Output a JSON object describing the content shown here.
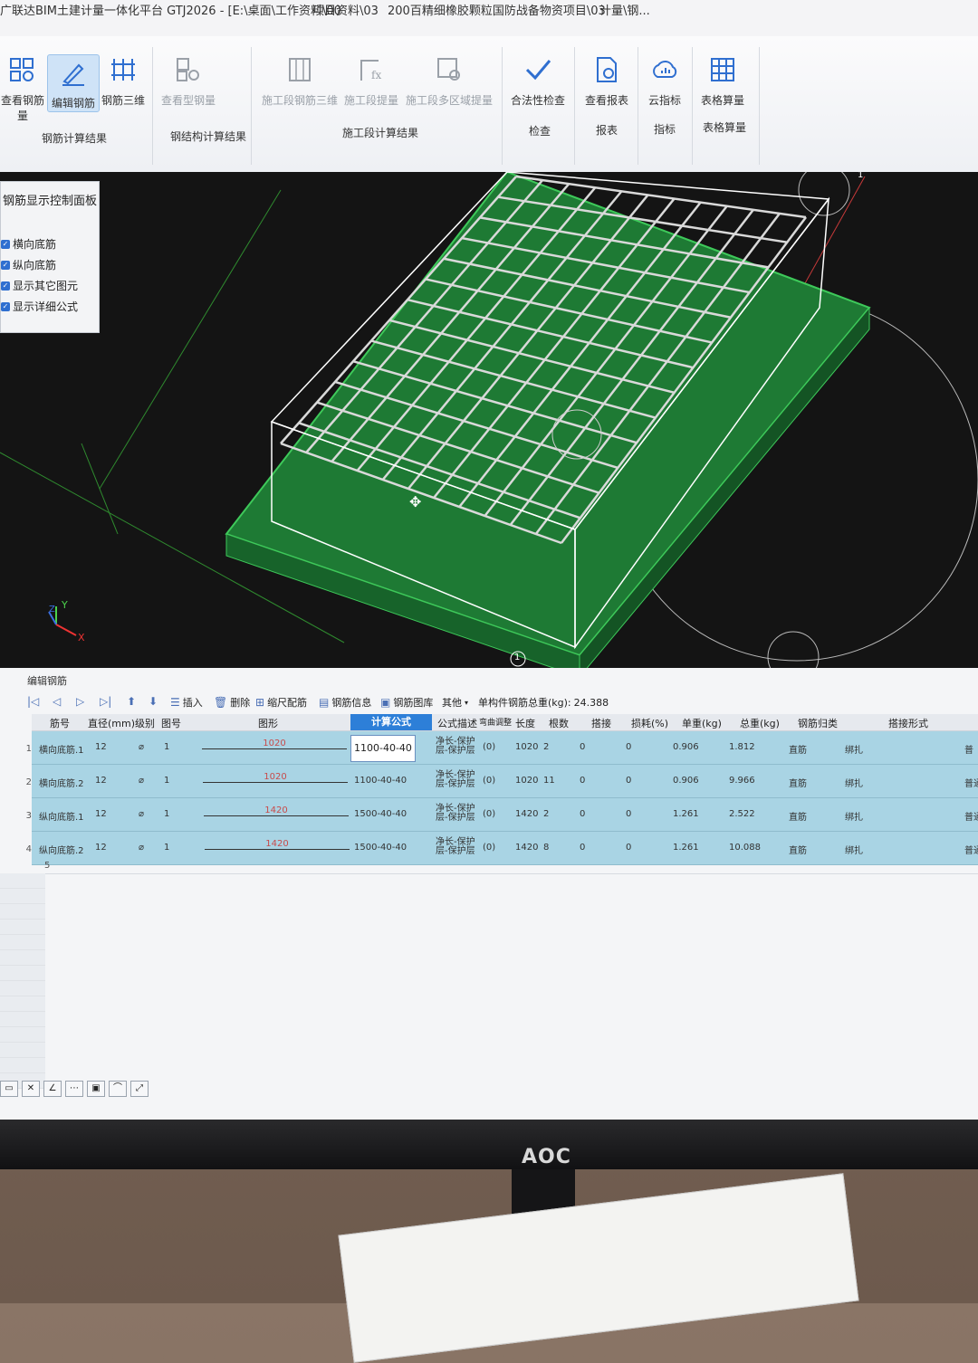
{
  "window": {
    "title_segments": [
      "广联达BIM土建计量一体化平台 GTJ2026 - [E:\\桌面\\工作资料\\00",
      "项目资料\\03",
      "200百精细橡胶颗粒国防战备物资项目\\03",
      "计量\\钢..."
    ]
  },
  "ribbon": {
    "buttons": [
      {
        "label": "查看钢筋量",
        "icon": "rebar-qty-icon",
        "state": "normal"
      },
      {
        "label": "编辑钢筋",
        "icon": "edit-rebar-icon",
        "state": "active"
      },
      {
        "label": "钢筋三维",
        "icon": "rebar-3d-icon",
        "state": "normal"
      },
      {
        "label": "查看型钢量",
        "icon": "steel-qty-icon",
        "state": "disabled"
      },
      {
        "label": "施工段钢筋三维",
        "icon": "segment-3d-icon",
        "state": "disabled"
      },
      {
        "label": "施工段提量",
        "icon": "segment-qty-icon",
        "state": "disabled"
      },
      {
        "label": "施工段多区域提量",
        "icon": "multi-area-icon",
        "state": "disabled"
      },
      {
        "label": "合法性检查",
        "icon": "check-icon",
        "state": "normal"
      },
      {
        "label": "查看报表",
        "icon": "report-icon",
        "state": "normal"
      },
      {
        "label": "云指标",
        "icon": "cloud-icon",
        "state": "normal"
      },
      {
        "label": "表格算量",
        "icon": "table-icon",
        "state": "normal"
      }
    ],
    "groups": [
      "钢筋计算结果",
      "钢结构计算结果",
      "施工段计算结果",
      "检查",
      "报表",
      "指标",
      "表格算量"
    ]
  },
  "control_panel": {
    "title": "钢筋显示控制面板",
    "items": [
      {
        "label": "横向底筋",
        "checked": true
      },
      {
        "label": "纵向底筋",
        "checked": true
      },
      {
        "label": "显示其它图元",
        "checked": true
      },
      {
        "label": "显示详细公式",
        "checked": true
      }
    ]
  },
  "viewport": {
    "axis_marker": "1",
    "axis_x": "X",
    "axis_y": "Y",
    "axis_z": "Z"
  },
  "editor": {
    "title": "编辑钢筋",
    "toolbar": {
      "insert": "插入",
      "delete": "删除",
      "scale": "缩尺配筋",
      "info": "钢筋信息",
      "library": "钢筋图库",
      "other": "其他",
      "total_label": "单构件钢筋总重(kg):",
      "total_value": "24.388"
    },
    "columns": [
      "筋号",
      "直径(mm)",
      "级别",
      "图号",
      "图形",
      "计算公式",
      "公式描述",
      "弯曲调整",
      "长度",
      "根数",
      "搭接",
      "损耗(%)",
      "单重(kg)",
      "总重(kg)",
      "钢筋归类",
      "搭接形式"
    ],
    "rows": [
      {
        "num": "1",
        "name": "横向底筋.1",
        "diameter": "12",
        "grade": "⌀",
        "fig": "1",
        "shape": "1020",
        "formula": "1100-40-40",
        "desc": "净长-保护层-保护层",
        "bend": "(0)",
        "length": "1020",
        "count": "2",
        "lap": "0",
        "loss": "0",
        "unit_weight": "0.906",
        "total_weight": "1.812",
        "category": "直筋",
        "lap_type": "绑扎",
        "extra": "普"
      },
      {
        "num": "2",
        "name": "横向底筋.2",
        "diameter": "12",
        "grade": "⌀",
        "fig": "1",
        "shape": "1020",
        "formula": "1100-40-40",
        "desc": "净长-保护层-保护层",
        "bend": "(0)",
        "length": "1020",
        "count": "11",
        "lap": "0",
        "loss": "0",
        "unit_weight": "0.906",
        "total_weight": "9.966",
        "category": "直筋",
        "lap_type": "绑扎",
        "extra": "普通"
      },
      {
        "num": "3",
        "name": "纵向底筋.1",
        "diameter": "12",
        "grade": "⌀",
        "fig": "1",
        "shape": "1420",
        "formula": "1500-40-40",
        "desc": "净长-保护层-保护层",
        "bend": "(0)",
        "length": "1420",
        "count": "2",
        "lap": "0",
        "loss": "0",
        "unit_weight": "1.261",
        "total_weight": "2.522",
        "category": "直筋",
        "lap_type": "绑扎",
        "extra": "普通"
      },
      {
        "num": "4",
        "name": "纵向底筋.2",
        "diameter": "12",
        "grade": "⌀",
        "fig": "1",
        "shape": "1420",
        "formula": "1500-40-40",
        "desc": "净长-保护层-保护层",
        "bend": "(0)",
        "length": "1420",
        "count": "8",
        "lap": "0",
        "loss": "0",
        "unit_weight": "1.261",
        "total_weight": "10.088",
        "category": "直筋",
        "lap_type": "绑扎",
        "extra": "普通"
      }
    ],
    "empty_row_num": "5"
  },
  "monitor": {
    "brand": "AOC"
  }
}
